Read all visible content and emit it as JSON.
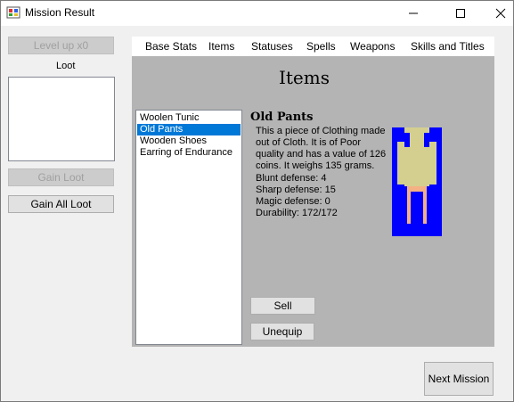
{
  "window": {
    "title": "Mission Result",
    "icon": "app-icon",
    "controls": [
      "minimize-icon",
      "maximize-icon",
      "close-icon"
    ]
  },
  "left": {
    "level_up_label": "Level up x0",
    "loot_label": "Loot",
    "loot_items": [],
    "gain_loot_label": "Gain Loot",
    "gain_all_loot_label": "Gain All Loot"
  },
  "tabs": [
    "Base Stats",
    "Items",
    "Statuses",
    "Spells",
    "Weapons",
    "Skills and Titles"
  ],
  "panel": {
    "title": "Items",
    "items": [
      "Woolen Tunic",
      "Old Pants",
      "Wooden Shoes",
      "Earring of Endurance"
    ],
    "selected_index": 1,
    "detail": {
      "name": "Old Pants",
      "description": "This a piece of Clothing made out of Cloth. It is of Poor quality and has a value of 126 coins. It weighs 135 grams.",
      "blunt": "Blunt defense: 4",
      "sharp": "Sharp defense: 15",
      "magic": "Magic defense: 0",
      "durability": "Durability: 172/172"
    },
    "sell_label": "Sell",
    "unequip_label": "Unequip",
    "sprite_colors": {
      "background": "#0000ff",
      "body": "#d4cf8f",
      "highlight": "#f4b183"
    }
  },
  "next_mission_label": "Next Mission"
}
